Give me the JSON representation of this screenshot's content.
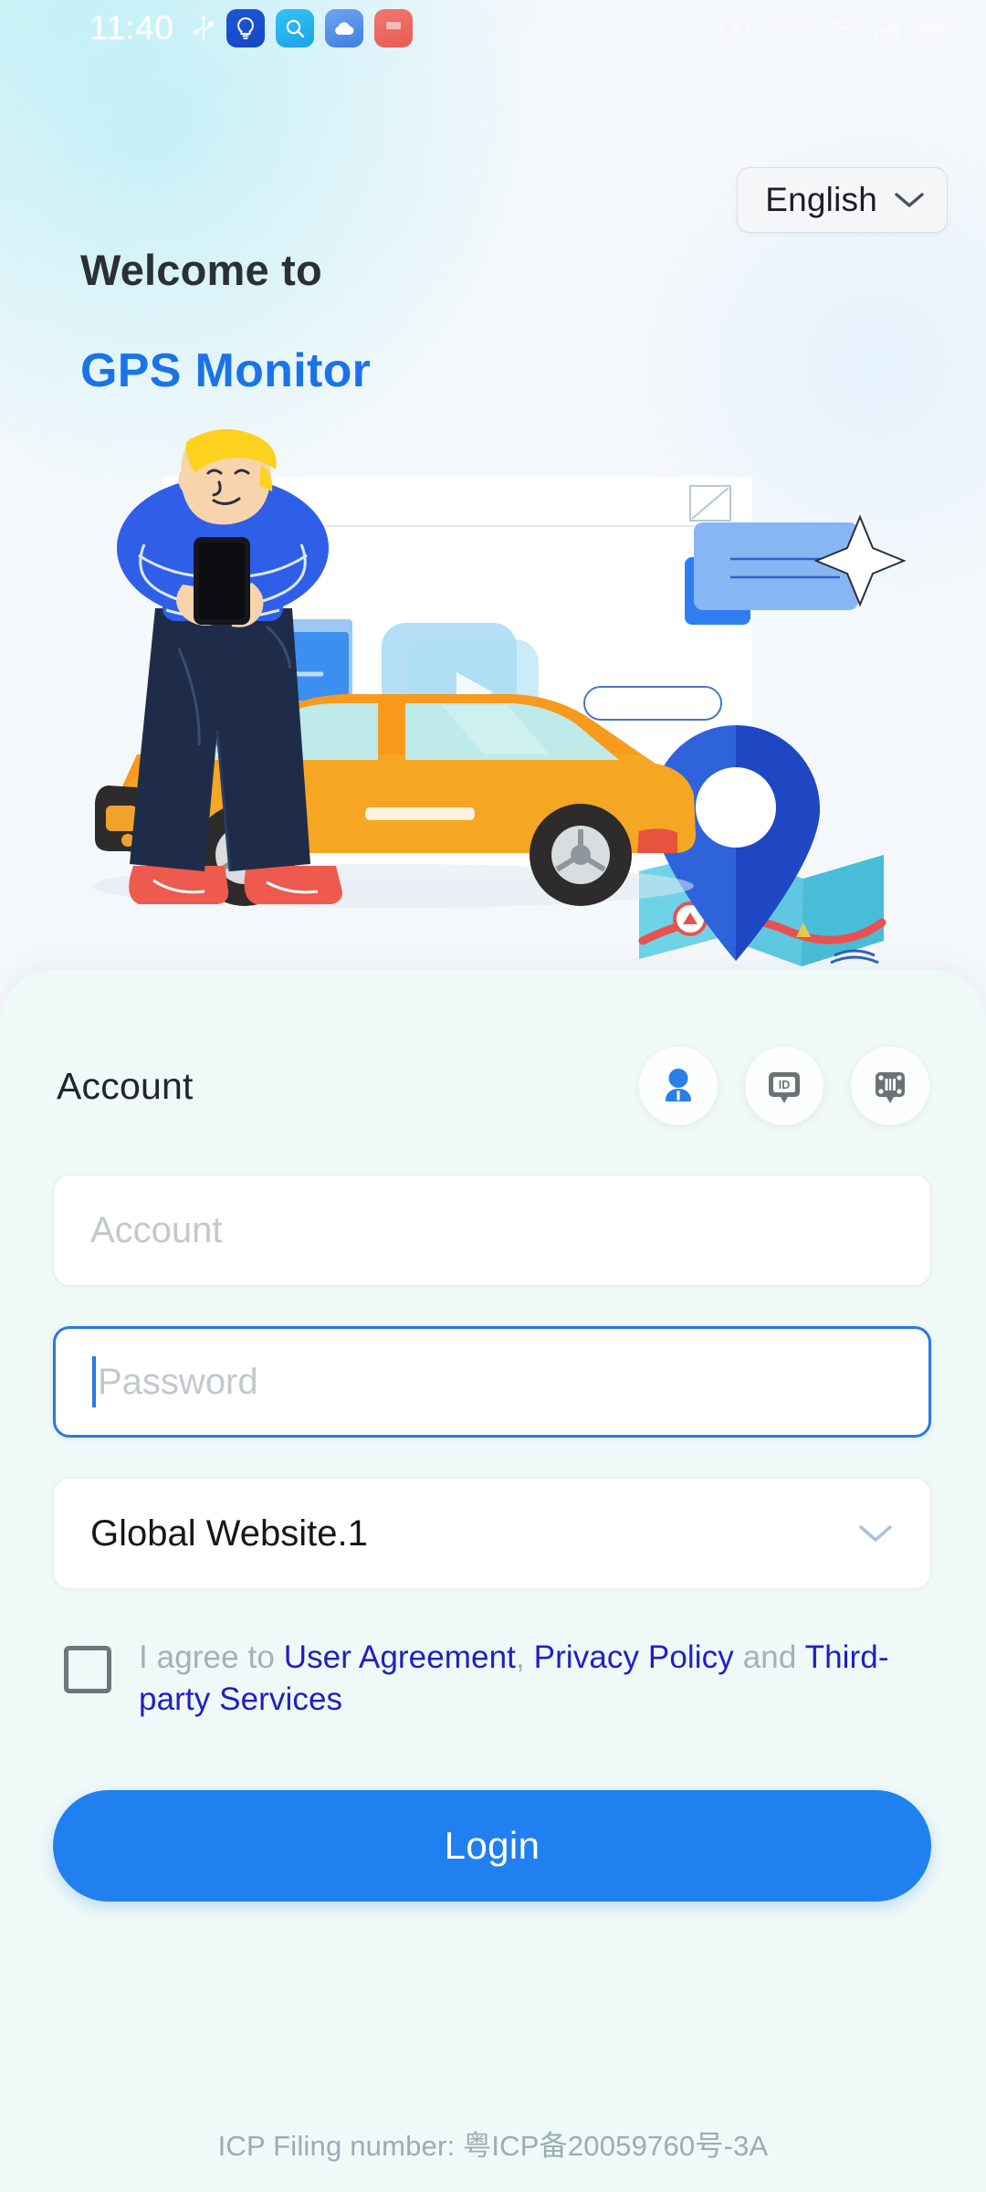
{
  "status_bar": {
    "time": "11:40",
    "usb_icon": "usb-icon",
    "notification_icons": [
      {
        "name": "lightbulb-app-icon",
        "color": "#1f55d4"
      },
      {
        "name": "search-app-icon",
        "color": "#26b4ef"
      },
      {
        "name": "cloud-app-icon",
        "color": "#5a95ea"
      },
      {
        "name": "red-badge-app-icon",
        "color": "#ef554a"
      }
    ],
    "data_speed": "15.9 K/s",
    "right_icons": [
      "eye-icon",
      "data-speed-icon",
      "wifi-icon",
      "signal-icon",
      "battery-icon"
    ]
  },
  "language": {
    "selected": "English",
    "chevron_icon": "chevron-down-icon"
  },
  "hero": {
    "welcome_line": "Welcome to",
    "app_name": "GPS Monitor",
    "illustration_name": "person-with-phone-car-map-illustration"
  },
  "login_card": {
    "account_title": "Account",
    "mode_buttons": [
      {
        "name": "login-mode-account-button",
        "icon": "person-icon",
        "active": true,
        "color": "#2a7fe8"
      },
      {
        "name": "login-mode-id-button",
        "icon": "id-card-icon",
        "active": false,
        "color": "#6b7276"
      },
      {
        "name": "login-mode-imei-button",
        "icon": "imei-device-icon",
        "active": false,
        "color": "#6b7276"
      }
    ],
    "account_input": {
      "value": "",
      "placeholder": "Account"
    },
    "password_input": {
      "value": "",
      "placeholder": "Password",
      "focused": true
    },
    "server_select": {
      "value": "Global Website.1",
      "chevron_icon": "chevron-down-icon"
    },
    "agreement": {
      "checked": false,
      "prefix": "I agree to ",
      "link_user_agreement": "User Agreement",
      "separator_1": ", ",
      "link_privacy_policy": "Privacy Policy",
      "separator_2": " and ",
      "link_third_party": "Third-party Services"
    },
    "login_button_label": "Login",
    "icp_footer": "ICP Filing number: 粤ICP备20059760号-3A"
  },
  "colors": {
    "brand_blue": "#1a73e8",
    "button_blue": "#2180f0",
    "focus_blue": "#2a79e0",
    "link_blue": "#1f1fc4",
    "card_bg": "#eff9f7",
    "bg_cyan": "#cdf4f7"
  }
}
